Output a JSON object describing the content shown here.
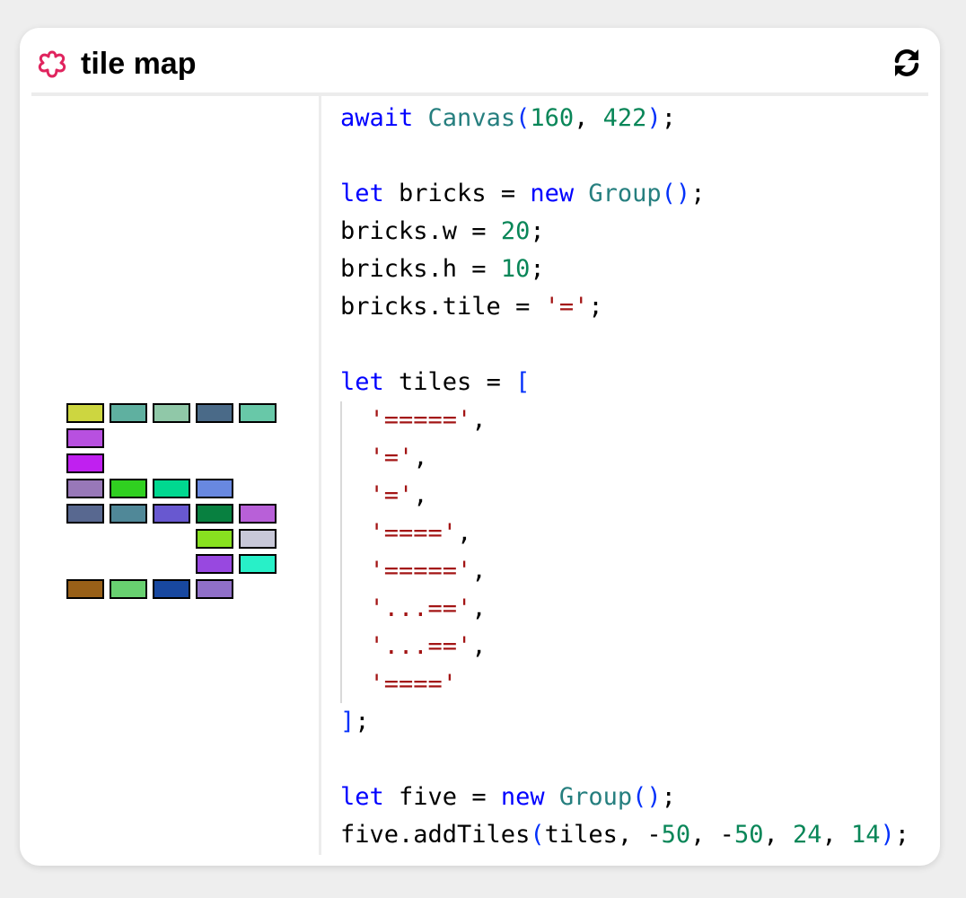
{
  "window": {
    "title": "tile map",
    "title_icon": "flower-icon",
    "refresh_icon": "refresh-icon",
    "accent_color": "#e0245e"
  },
  "tile_map": {
    "rows": [
      [
        "#cdd640",
        "#5fb0a0",
        "#90c8a8",
        "#4a6a88",
        "#68c8a8"
      ],
      [
        "#b850e0"
      ],
      [
        "#c020f0"
      ],
      [
        "#9878b8",
        "#30d020",
        "#00d890",
        "#6888e0"
      ],
      [
        "#586890",
        "#508898",
        "#6858d0",
        "#088040",
        "#b860d8"
      ],
      [
        null,
        null,
        null,
        "#88e020",
        "#c8c8d8"
      ],
      [
        null,
        null,
        null,
        "#9848e0",
        "#28f0c8"
      ],
      [
        "#986018",
        "#68d070",
        "#1848a0",
        "#9070c8"
      ]
    ]
  },
  "code": {
    "colors": {
      "key": "#0000ff",
      "fn": "#267f7f",
      "num": "#098658",
      "str": "#a31515",
      "bracket": "#0431fa"
    },
    "lines": [
      [
        [
          "key",
          "await"
        ],
        [
          "plain",
          " "
        ],
        [
          "fn",
          "Canvas"
        ],
        [
          "br",
          "("
        ],
        [
          "num",
          "160"
        ],
        [
          "plain",
          ", "
        ],
        [
          "num",
          "422"
        ],
        [
          "br",
          ")"
        ],
        [
          "plain",
          ";"
        ]
      ],
      [],
      [
        [
          "key",
          "let"
        ],
        [
          "plain",
          " bricks = "
        ],
        [
          "key",
          "new"
        ],
        [
          "plain",
          " "
        ],
        [
          "fn",
          "Group"
        ],
        [
          "br",
          "()"
        ],
        [
          "plain",
          ";"
        ]
      ],
      [
        [
          "plain",
          "bricks.w = "
        ],
        [
          "num",
          "20"
        ],
        [
          "plain",
          ";"
        ]
      ],
      [
        [
          "plain",
          "bricks.h = "
        ],
        [
          "num",
          "10"
        ],
        [
          "plain",
          ";"
        ]
      ],
      [
        [
          "plain",
          "bricks.tile = "
        ],
        [
          "str",
          "'='"
        ],
        [
          "plain",
          ";"
        ]
      ],
      [],
      [
        [
          "key",
          "let"
        ],
        [
          "plain",
          " tiles = "
        ],
        [
          "br",
          "["
        ]
      ],
      [
        [
          "plain",
          "  "
        ],
        [
          "str",
          "'====='"
        ],
        [
          "plain",
          ","
        ]
      ],
      [
        [
          "plain",
          "  "
        ],
        [
          "str",
          "'='"
        ],
        [
          "plain",
          ","
        ]
      ],
      [
        [
          "plain",
          "  "
        ],
        [
          "str",
          "'='"
        ],
        [
          "plain",
          ","
        ]
      ],
      [
        [
          "plain",
          "  "
        ],
        [
          "str",
          "'===='"
        ],
        [
          "plain",
          ","
        ]
      ],
      [
        [
          "plain",
          "  "
        ],
        [
          "str",
          "'====='"
        ],
        [
          "plain",
          ","
        ]
      ],
      [
        [
          "plain",
          "  "
        ],
        [
          "str",
          "'...=='"
        ],
        [
          "plain",
          ","
        ]
      ],
      [
        [
          "plain",
          "  "
        ],
        [
          "str",
          "'...=='"
        ],
        [
          "plain",
          ","
        ]
      ],
      [
        [
          "plain",
          "  "
        ],
        [
          "str",
          "'===='"
        ]
      ],
      [
        [
          "br",
          "]"
        ],
        [
          "plain",
          ";"
        ]
      ],
      [],
      [
        [
          "key",
          "let"
        ],
        [
          "plain",
          " five = "
        ],
        [
          "key",
          "new"
        ],
        [
          "plain",
          " "
        ],
        [
          "fn",
          "Group"
        ],
        [
          "br",
          "()"
        ],
        [
          "plain",
          ";"
        ]
      ],
      [
        [
          "plain",
          "five.addTiles"
        ],
        [
          "br",
          "("
        ],
        [
          "plain",
          "tiles, -"
        ],
        [
          "num",
          "50"
        ],
        [
          "plain",
          ", -"
        ],
        [
          "num",
          "50"
        ],
        [
          "plain",
          ", "
        ],
        [
          "num",
          "24"
        ],
        [
          "plain",
          ", "
        ],
        [
          "num",
          "14"
        ],
        [
          "br",
          ")"
        ],
        [
          "plain",
          ";"
        ]
      ]
    ]
  }
}
